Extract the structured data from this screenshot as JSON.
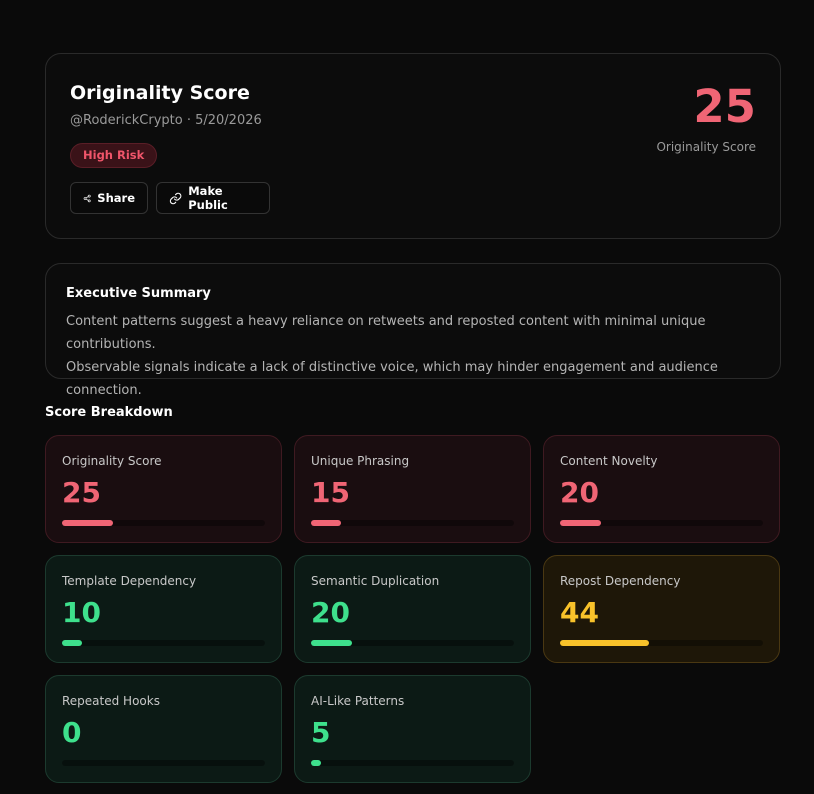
{
  "header": {
    "title": "Originality Score",
    "subtitle": "@RoderickCrypto · 5/20/2026",
    "risk_badge": "High Risk",
    "share_label": "Share",
    "make_public_label": "Make Public",
    "score": "25",
    "score_label": "Originality Score"
  },
  "summary": {
    "title": "Executive Summary",
    "text_line1": "Content patterns suggest a heavy reliance on retweets and reposted content with minimal unique contributions.",
    "text_line2": "Observable signals indicate a lack of distinctive voice, which may hinder engagement and audience connection."
  },
  "breakdown": {
    "title": "Score Breakdown",
    "metrics": [
      {
        "label": "Originality Score",
        "value": "25",
        "percent": 25,
        "tone": "red"
      },
      {
        "label": "Unique Phrasing",
        "value": "15",
        "percent": 15,
        "tone": "red"
      },
      {
        "label": "Content Novelty",
        "value": "20",
        "percent": 20,
        "tone": "red"
      },
      {
        "label": "Template Dependency",
        "value": "10",
        "percent": 10,
        "tone": "green"
      },
      {
        "label": "Semantic Duplication",
        "value": "20",
        "percent": 20,
        "tone": "green"
      },
      {
        "label": "Repost Dependency",
        "value": "44",
        "percent": 44,
        "tone": "yellow"
      },
      {
        "label": "Repeated Hooks",
        "value": "0",
        "percent": 0,
        "tone": "green"
      },
      {
        "label": "AI-Like Patterns",
        "value": "5",
        "percent": 5,
        "tone": "green"
      }
    ]
  },
  "colors": {
    "red": "#f06575",
    "green": "#3ee08c",
    "yellow": "#f8c22a",
    "background": "#0a0a0a"
  },
  "icons": {
    "share": "share-icon",
    "make_public": "link-icon"
  }
}
